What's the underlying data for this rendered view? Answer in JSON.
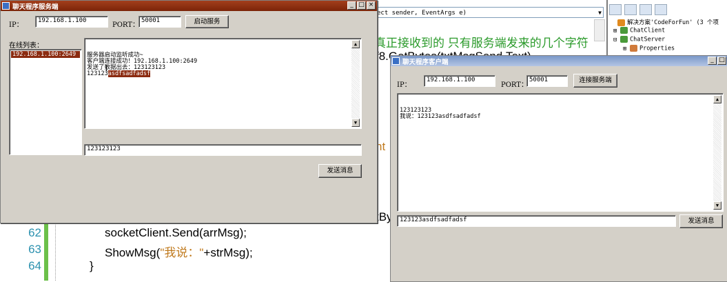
{
  "ide": {
    "method_dropdown": "ect sender, EventArgs e)",
    "comment_fragment": "真正接收到的 只有服务端发来的几个字符",
    "code_fragment_top": "f8.GetBytes(txtMsgSend.Text)",
    "code_fragment_nt": "nt",
    "code_fragment_by": "tBy",
    "line_numbers": [
      "62",
      "63",
      "64"
    ],
    "code_lines": [
      {
        "parts": [
          {
            "text": "socketClient.Send(arrMsg);",
            "cls": ""
          }
        ]
      },
      {
        "parts": [
          {
            "text": "ShowMsg(",
            "cls": ""
          },
          {
            "text": "\"我说：\"",
            "cls": "brown"
          },
          {
            "text": "+strMsg);",
            "cls": ""
          }
        ]
      },
      {
        "parts": [
          {
            "text": "}",
            "cls": ""
          }
        ]
      }
    ],
    "solution_explorer": {
      "items": [
        {
          "text": "解决方案'CodeForFun' (3 个项",
          "expander": "",
          "icon_color": "#e08a1e"
        },
        {
          "text": "ChatClient",
          "expander": "⊞",
          "icon_color": "#4a9a3a"
        },
        {
          "text": "ChatServer",
          "expander": "⊟",
          "icon_color": "#4a9a3a"
        },
        {
          "text": "Properties",
          "expander": "⊞",
          "icon_color": "#d07a3a"
        }
      ]
    }
  },
  "server": {
    "title": "聊天程序服务端",
    "ip_label": "IP：",
    "ip_value": "192.168.1.100",
    "port_label": "PORT：",
    "port_value": "50001",
    "start_button": "启动服务",
    "online_label": "在线列表：",
    "online_list": [
      "192.168.1.100:2649"
    ],
    "log_lines": [
      "服务器启动监听成功~",
      "客户端连接成功！192.168.1.100:2649",
      "发送了数据出去：123123123"
    ],
    "log_last_plain": "123123",
    "log_last_selected": "asdfsadfadsf",
    "send_input": "123123123",
    "send_button": "发送消息"
  },
  "client": {
    "title": "聊天程序客户端",
    "ip_label": "IP：",
    "ip_value": "192.168.1.100",
    "port_label": "PORT：",
    "port_value": "50001",
    "connect_button": "连接服务端",
    "log_lines": [
      "123123123",
      "我说：123123asdfsadfadsf"
    ],
    "send_input": "123123asdfsadfadsf",
    "send_button": "发送消息"
  },
  "window_controls": {
    "minimize": "_",
    "maximize": "□",
    "close": "×"
  }
}
